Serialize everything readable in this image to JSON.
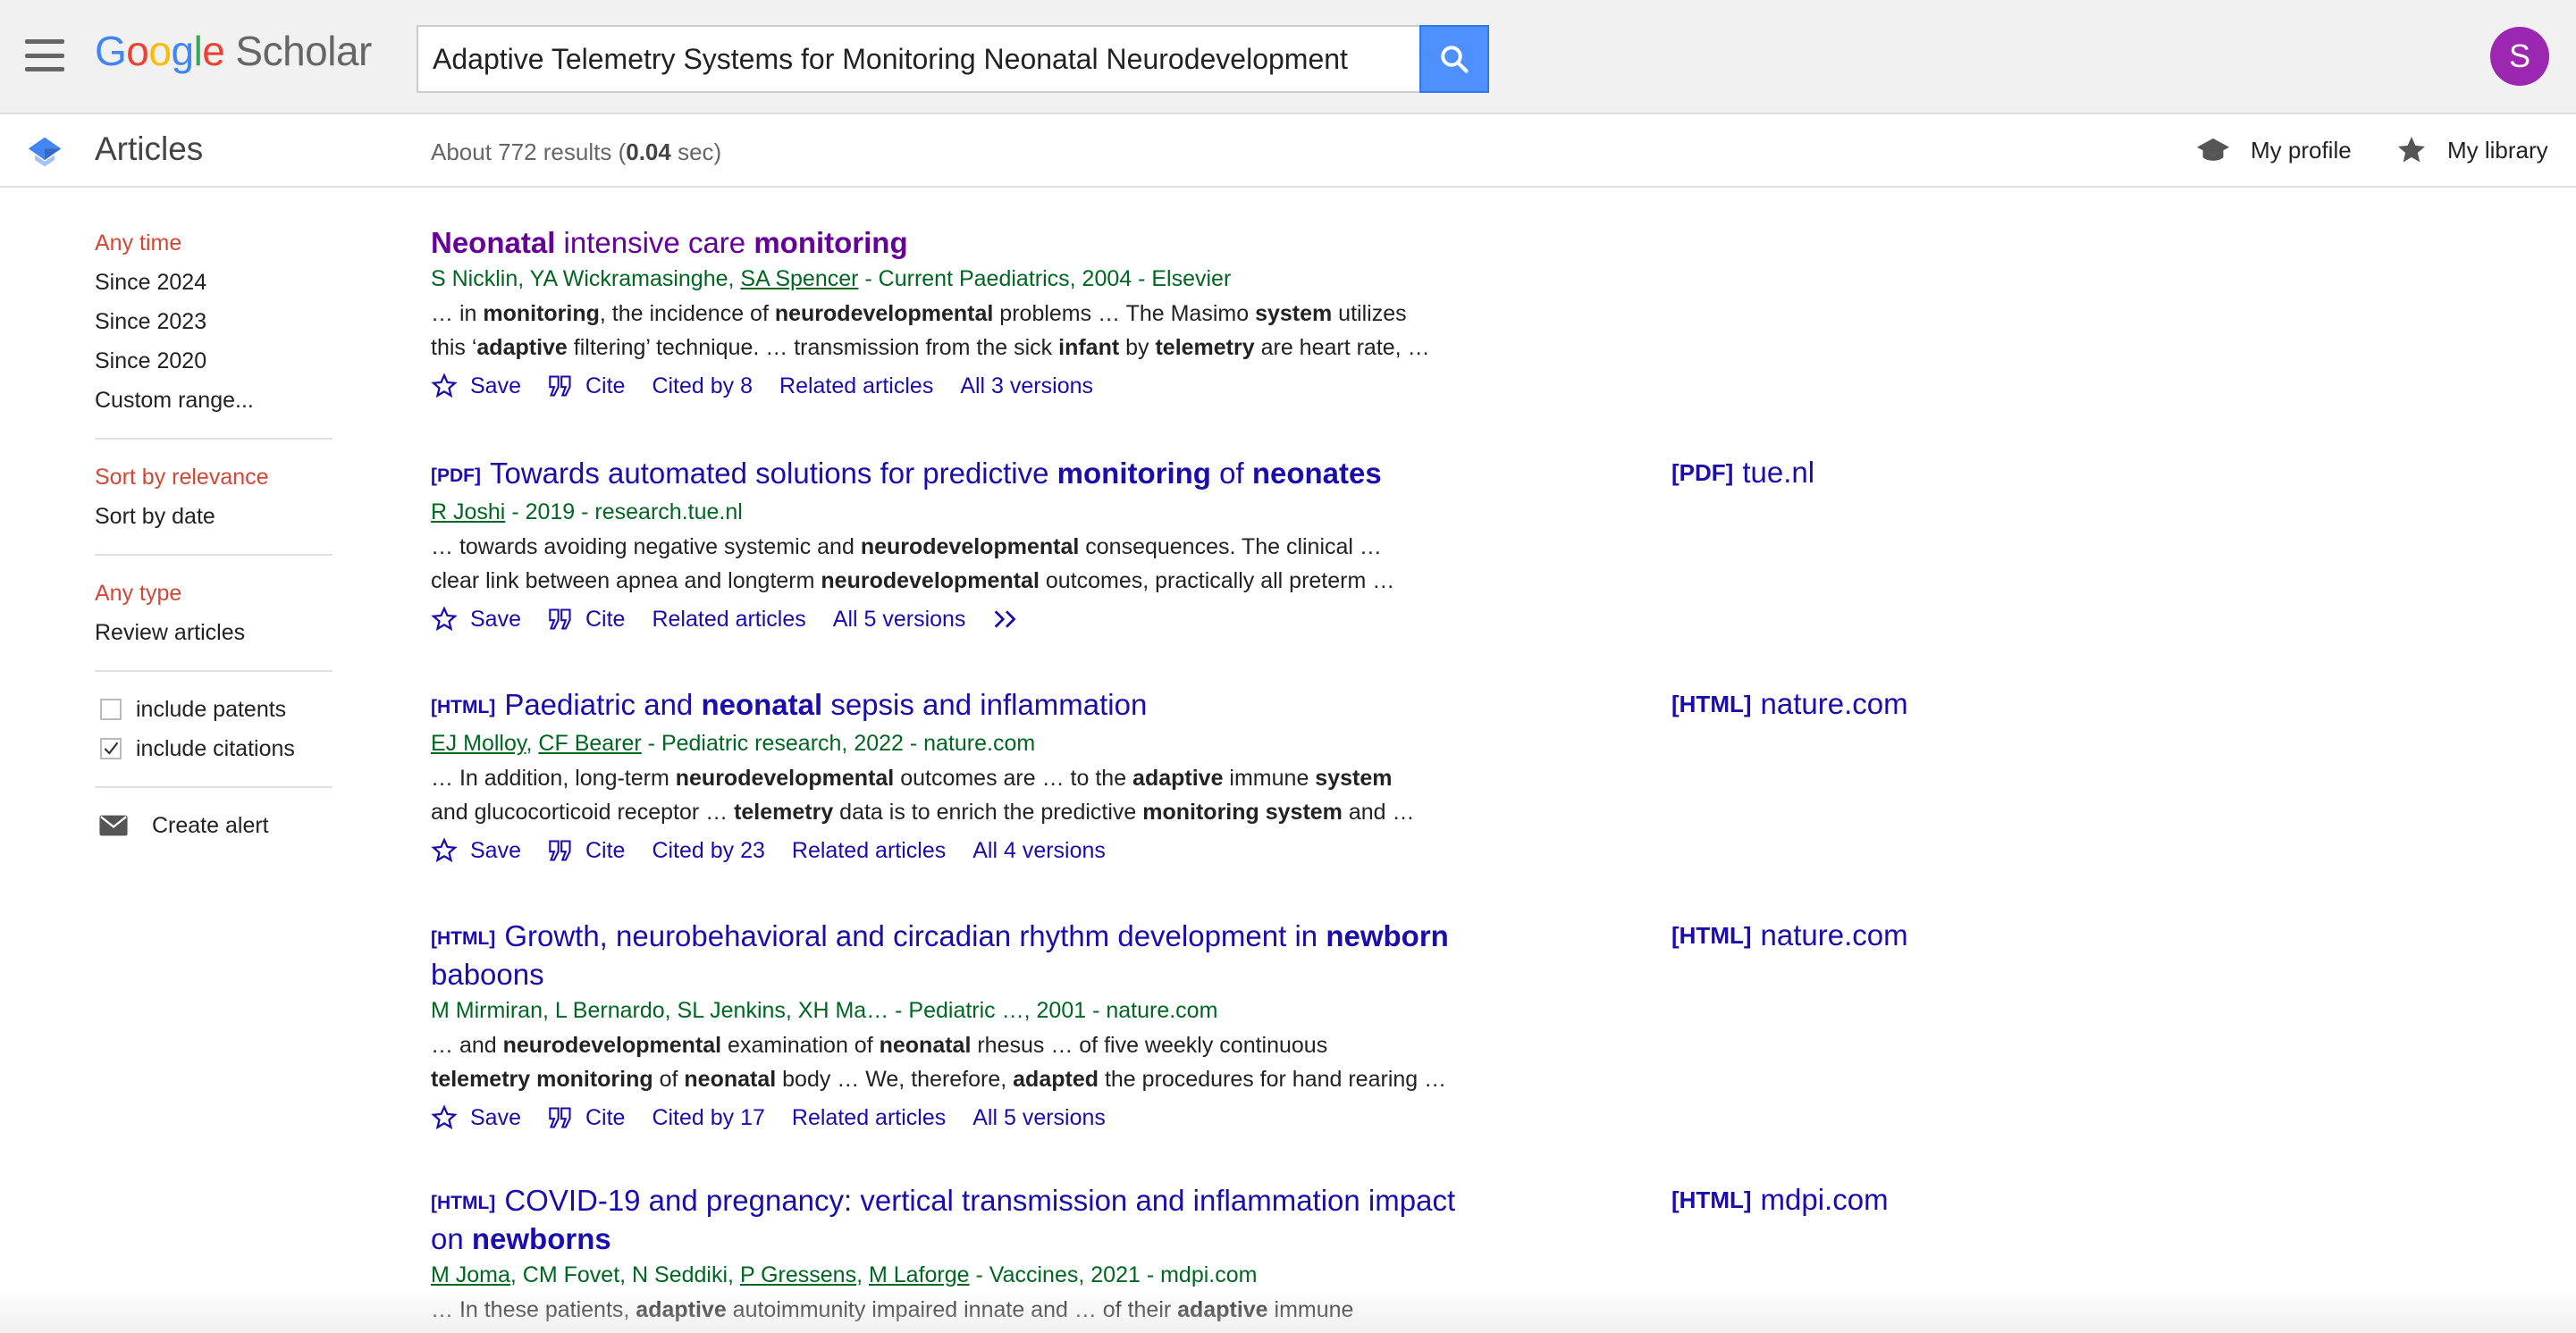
{
  "header": {
    "logo": {
      "G": "G",
      "o1": "o",
      "o2": "o",
      "g": "g",
      "l": "l",
      "e": "e",
      "scholar": "Scholar"
    },
    "search_value": "Adaptive Telemetry Systems for Monitoring Neonatal Neurodevelopment",
    "avatar_letter": "S"
  },
  "subheader": {
    "title": "Articles",
    "results_prefix": "About 772 results (",
    "results_time": "0.04",
    "results_suffix": " sec)",
    "my_profile": "My profile",
    "my_library": "My library"
  },
  "sidebar": {
    "time_filters": [
      "Any time",
      "Since 2024",
      "Since 2023",
      "Since 2020",
      "Custom range..."
    ],
    "sort_options": [
      "Sort by relevance",
      "Sort by date"
    ],
    "type_filters": [
      "Any type",
      "Review articles"
    ],
    "include_patents": "include patents",
    "include_citations": "include citations",
    "create_alert": "Create alert"
  },
  "results": [
    {
      "title_parts": [
        {
          "t": "Neonatal",
          "b": true
        },
        {
          "t": " intensive care ",
          "b": false
        },
        {
          "t": "monitoring",
          "b": true
        }
      ],
      "authors": "S Nicklin, YA Wickramasinghe, ",
      "author_link": "SA Spencer",
      "source": " - Current Paediatrics, 2004 - Elsevier",
      "snippet1": "… in <b>monitoring</b>, the incidence of <b>neurodevelopmental</b> problems … The Masimo <b>system</b> utilizes",
      "snippet2": "this ‘<b>adaptive</b> filtering’ technique. … transmission from the sick <b>infant</b> by <b>telemetry</b> are heart rate, …",
      "save": "Save",
      "cite": "Cite",
      "cited_by": "Cited by 8",
      "related": "Related articles",
      "versions": "All 3 versions"
    },
    {
      "tag": "[PDF]",
      "authors_link": "R Joshi",
      "source": " - 2019 - research.tue.nl",
      "snippet1": "… towards avoiding negative systemic and <b>neurodevelopmental</b> consequences. The clinical …",
      "snippet2": "clear link between apnea and longterm <b>neurodevelopmental</b> outcomes, practically all preterm …",
      "save": "Save",
      "cite": "Cite",
      "related": "Related articles",
      "versions": "All 5 versions",
      "side_tag": "[PDF]",
      "side_domain": "tue.nl"
    },
    {
      "tag": "[HTML]",
      "author_link1": "EJ Molloy",
      "author_link2": "CF Bearer",
      "source": " - Pediatric research, 2022 - nature.com",
      "snippet1": "… In addition, long-term <b>neurodevelopmental</b> outcomes are … to the <b>adaptive</b> immune <b>system</b>",
      "snippet2": "and glucocorticoid receptor … <b>telemetry</b> data is to enrich the predictive <b>monitoring system</b> and …",
      "save": "Save",
      "cite": "Cite",
      "cited_by": "Cited by 23",
      "related": "Related articles",
      "versions": "All 4 versions",
      "side_tag": "[HTML]",
      "side_domain": "nature.com"
    },
    {
      "tag": "[HTML]",
      "authors": "M Mirmiran, L Bernardo, SL Jenkins, XH Ma… - Pediatric …, 2001 - nature.com",
      "snippet1": "… and <b>neurodevelopmental</b> examination of <b>neonatal</b> rhesus … of five weekly continuous",
      "snippet2": "<b>telemetry monitoring</b> of <b>neonatal</b> body … We, therefore, <b>adapted</b> the procedures for hand rearing …",
      "save": "Save",
      "cite": "Cite",
      "cited_by": "Cited by 17",
      "related": "Related articles",
      "versions": "All 5 versions",
      "side_tag": "[HTML]",
      "side_domain": "nature.com"
    },
    {
      "tag": "[HTML]",
      "author_link1": "M Joma",
      "authors_mid": ", CM Fovet, N Seddiki, ",
      "author_link2": "P Gressens",
      "author_link3": "M Laforge",
      "source": " - Vaccines, 2021 - mdpi.com",
      "snippet1": "… In these patients, <b>adaptive</b> autoimmunity impaired innate and … of their <b>adaptive</b> immune",
      "side_tag": "[HTML]",
      "side_domain": "mdpi.com"
    }
  ],
  "result_titles": {
    "r2": {
      "a": "Towards automated solutions for predictive ",
      "b": "monitoring",
      "c": " of ",
      "d": "neonates"
    },
    "r3": {
      "a": "Paediatric and ",
      "b": "neonatal",
      "c": " sepsis and inflammation"
    },
    "r4": {
      "a": "Growth, neurobehavioral and circadian rhythm development in ",
      "b": "newborn",
      "c": "baboons"
    },
    "r5": {
      "a": "COVID-19 and pregnancy: vertical transmission and inflammation impact",
      "b": "on ",
      "c": "newborns"
    }
  },
  "colors": {
    "link": "#1a0dab",
    "visited": "#660099",
    "author_green": "#006621",
    "active_red": "#d14836",
    "search_blue": "#4d90fe",
    "avatar": "#9c27b0"
  }
}
